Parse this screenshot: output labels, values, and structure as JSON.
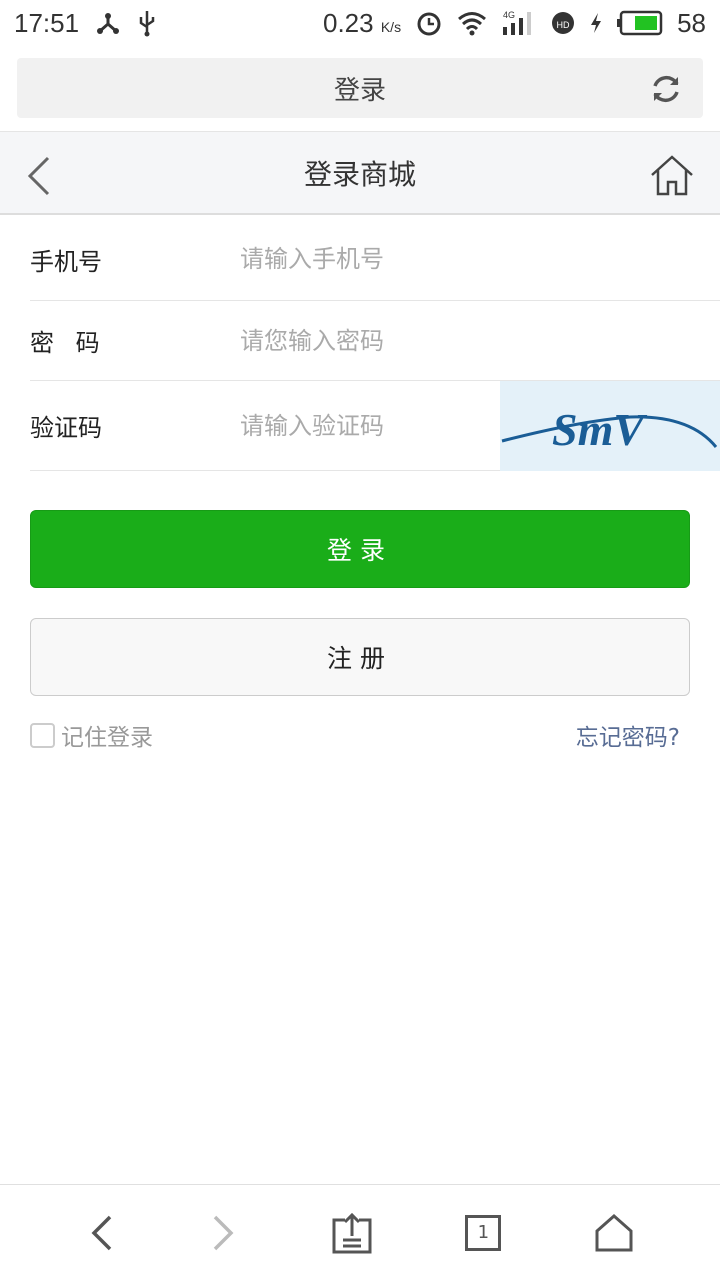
{
  "status": {
    "time": "17:51",
    "speed": "0.23",
    "speed_unit": "K/s",
    "network": "4G",
    "battery": "58",
    "battery_color": "#22c222"
  },
  "urlbar": {
    "title": "登录"
  },
  "header": {
    "title": "登录商城"
  },
  "form": {
    "phone": {
      "label": "手机号",
      "placeholder": "请输入手机号",
      "value": ""
    },
    "password": {
      "label": "密 码",
      "placeholder": "请您输入密码",
      "value": ""
    },
    "captcha": {
      "label": "验证码",
      "placeholder": "请输入验证码",
      "value": "",
      "image_text": "SmV"
    }
  },
  "buttons": {
    "login": "登录",
    "register": "注册",
    "login_color": "#1aad19"
  },
  "options": {
    "remember": "记住登录",
    "remember_checked": false,
    "forgot": "忘记密码?"
  },
  "bottom_nav": {
    "tabs_count": "1"
  }
}
